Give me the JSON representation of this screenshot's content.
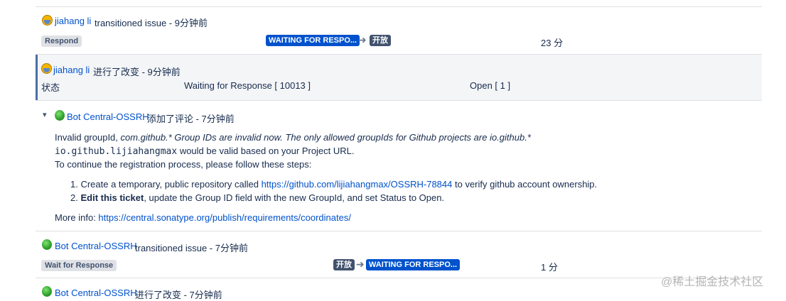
{
  "entry1": {
    "user": "jiahang li",
    "action": "transitioned issue - 9分钟前",
    "transition_label": "Respond",
    "from_status": "WAITING FOR RESPO...",
    "to_status": "开放",
    "duration": "23 分"
  },
  "entry2": {
    "user": "jiahang li",
    "action": "进行了改变 - 9分钟前",
    "field": "状态",
    "old_value": "Waiting for Response [ 10013 ]",
    "new_value": "Open [ 1 ]"
  },
  "comment": {
    "user": "Bot Central-OSSRH",
    "action": "添加了评论 - 7分钟前",
    "line1_prefix": "Invalid groupId, ",
    "line1_italic": "com.github.* Group IDs are invalid now. The only allowed groupIds for Github projects are io.github.*",
    "line2_code": "io.github.lijiahangmax",
    "line2_text": "would be valid based on your Project URL.",
    "line3": "To continue the registration process, please follow these steps:",
    "step1_prefix": "1. Create a temporary, public repository called ",
    "step1_link": "https://github.com/lijiahangmax/OSSRH-78844",
    "step1_suffix": " to verify github account ownership.",
    "step2_prefix": "2. ",
    "step2_bold": "Edit this ticket",
    "step2_suffix": ", update the Group ID field with the new GroupId, and set Status to Open.",
    "more_info_label": "More info: ",
    "more_info_link": "https://central.sonatype.org/publish/requirements/coordinates/"
  },
  "entry3": {
    "user": "Bot Central-OSSRH",
    "action": "transitioned issue - 7分钟前",
    "transition_label": "Wait for Response",
    "from_status": "开放",
    "to_status": "WAITING FOR RESPO...",
    "duration": "1 分"
  },
  "entry4": {
    "user": "Bot Central-OSSRH",
    "action": "进行了改变 - 7分钟前"
  },
  "watermark": "@稀土掘金技术社区"
}
